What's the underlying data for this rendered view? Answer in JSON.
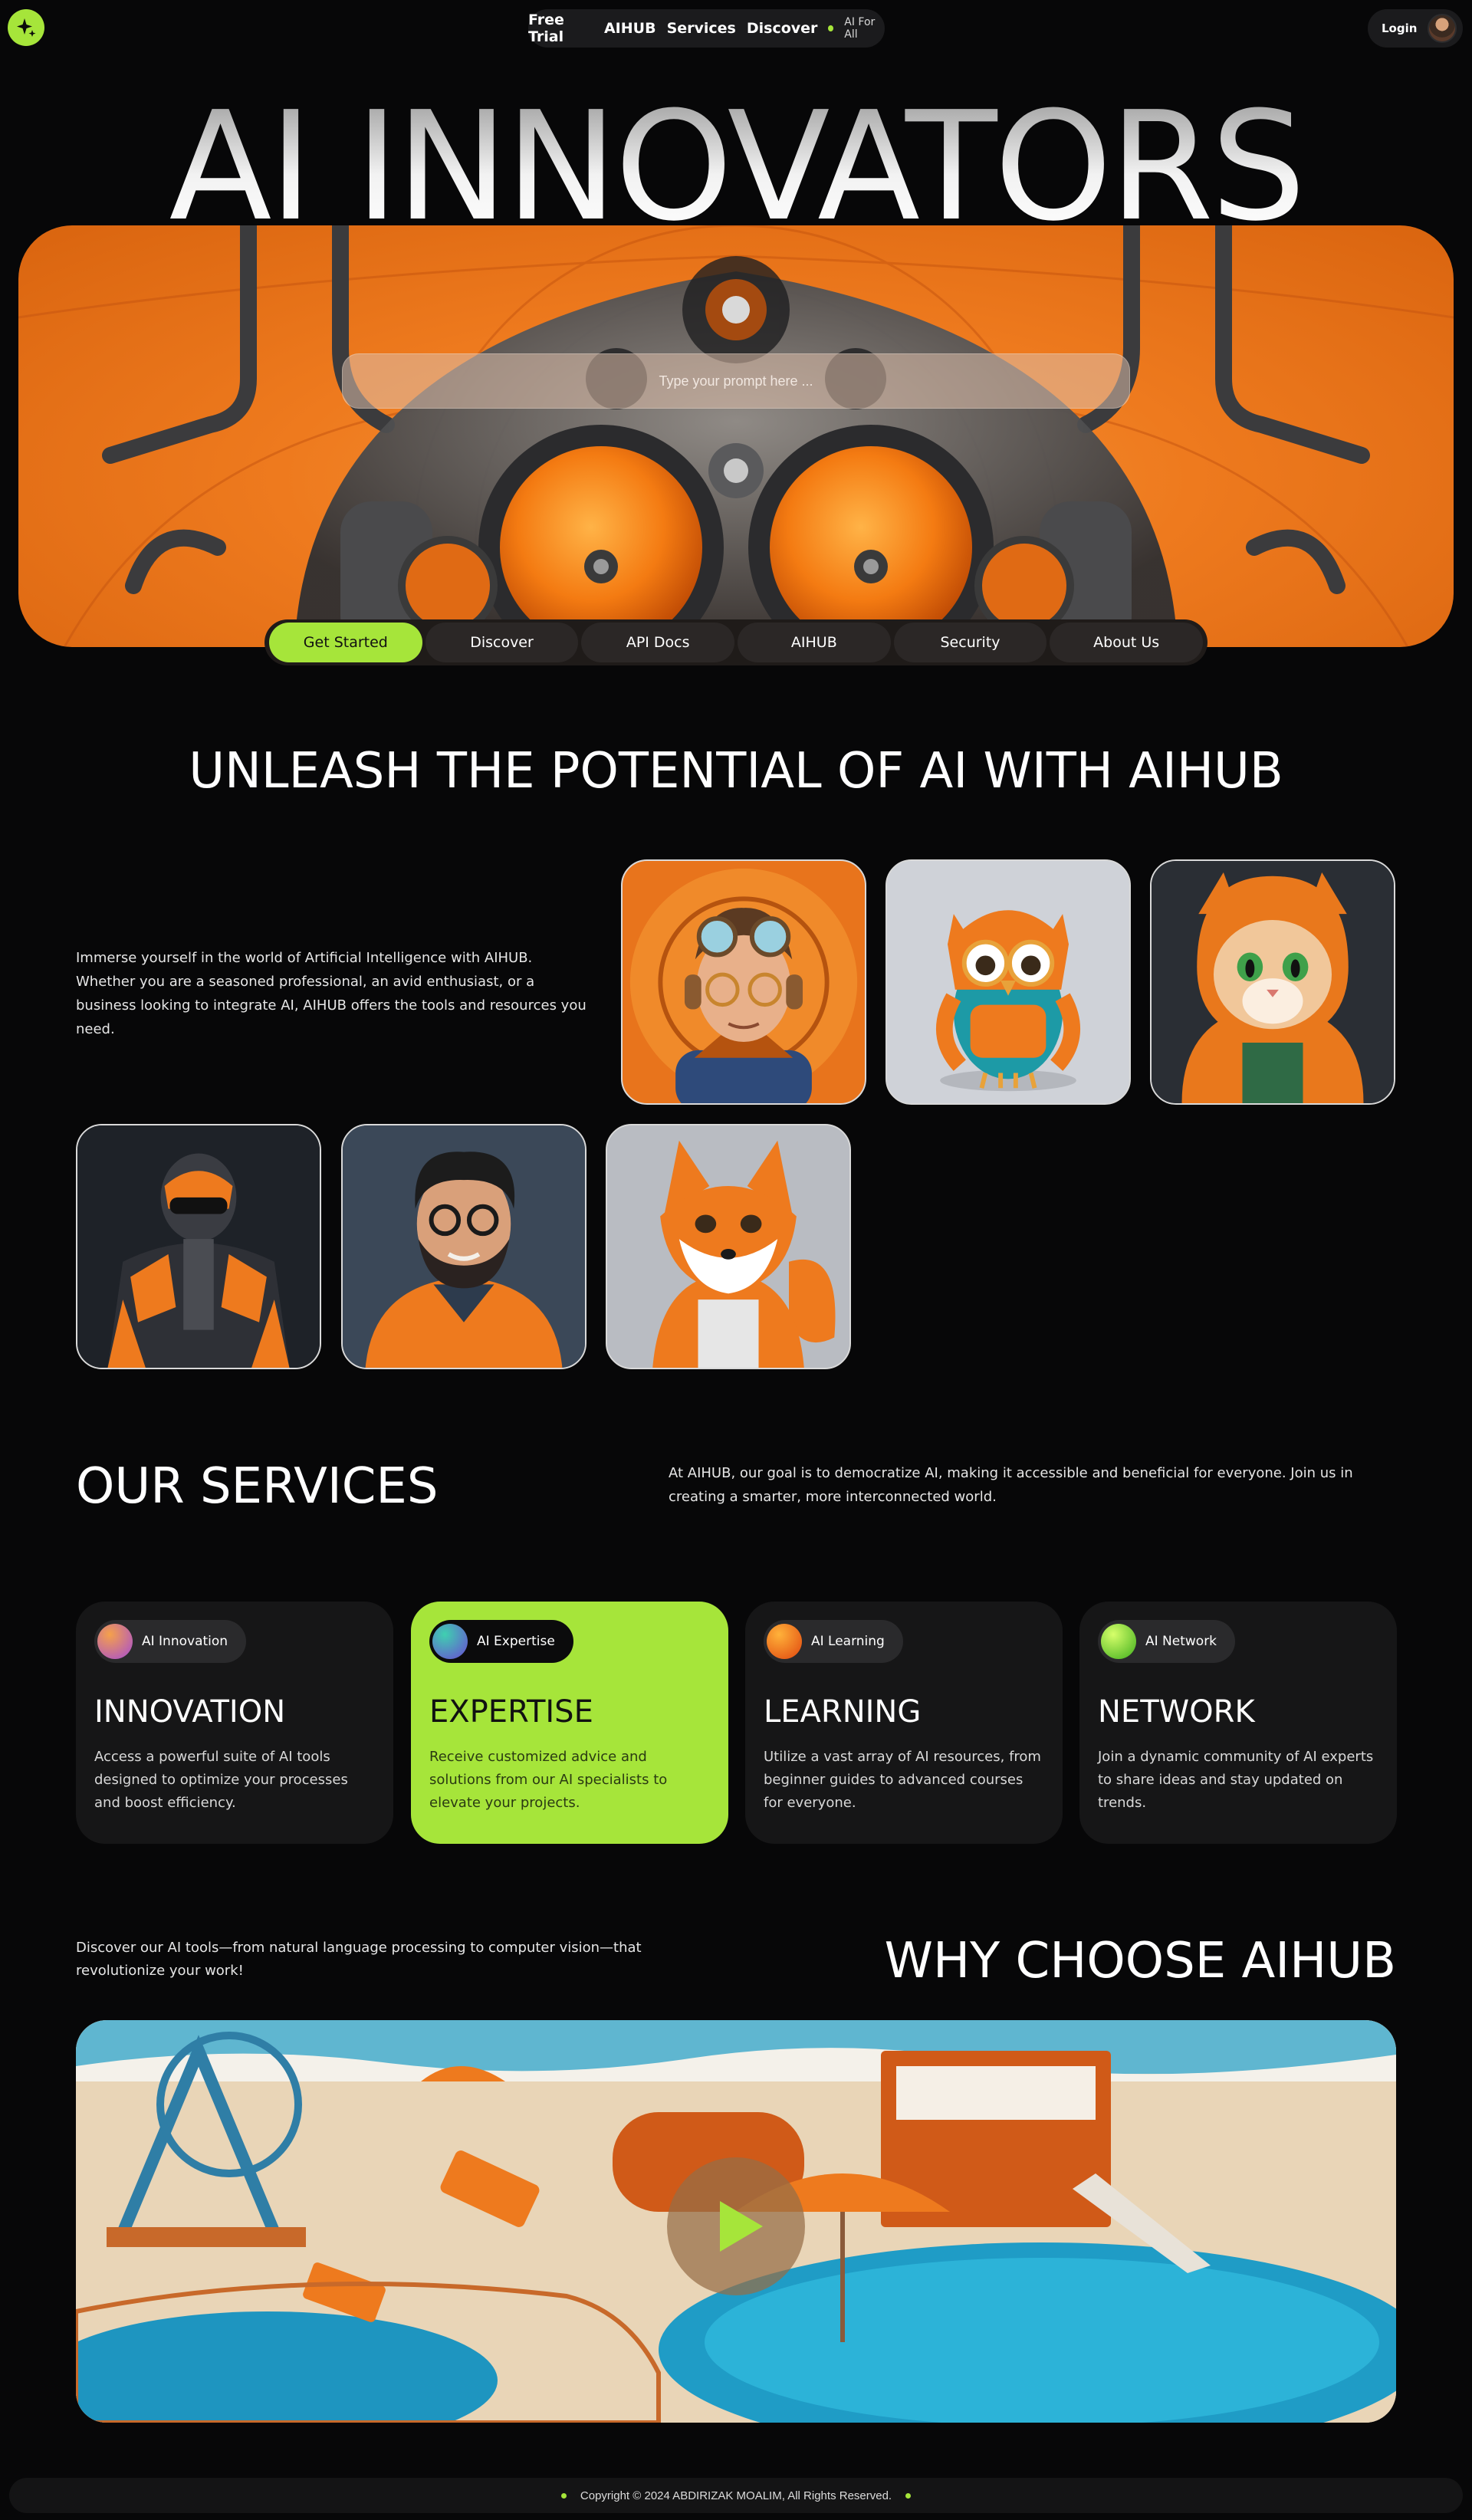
{
  "nav": {
    "links": [
      "Free Trial",
      "AIHUB",
      "Services",
      "Discover"
    ],
    "tagline": "AI For All",
    "login_label": "Login"
  },
  "hero": {
    "title": "AI INNOVATORS",
    "prompt_placeholder": "Type your prompt here ...",
    "tabs": [
      "Get Started",
      "Discover",
      "API Docs",
      "AIHUB",
      "Security",
      "About Us"
    ],
    "active_tab": "Get Started"
  },
  "unleash": {
    "title": "UNLEASH THE POTENTIAL OF AI WITH AIHUB",
    "intro": "Immerse yourself in the world of Artificial Intelligence with AIHUB. Whether you are a seasoned professional, an avid enthusiast, or a business looking to integrate AI, AIHUB offers the tools and resources you need."
  },
  "services": {
    "title": "OUR SERVICES",
    "description": "At AIHUB, our goal is to democratize AI, making it accessible and beneficial for everyone. Join us in creating a smarter, more interconnected world.",
    "cards": [
      {
        "pill": "AI Innovation",
        "heading": "INNOVATION",
        "text": "Access a powerful suite of AI tools designed to optimize your processes and boost efficiency."
      },
      {
        "pill": "AI Expertise",
        "heading": "EXPERTISE",
        "text": "Receive customized advice and solutions from our AI specialists to elevate your projects."
      },
      {
        "pill": "AI Learning",
        "heading": "LEARNING",
        "text": "Utilize a vast array of AI resources, from beginner guides to advanced courses for everyone."
      },
      {
        "pill": "AI Network",
        "heading": "NETWORK",
        "text": "Join a dynamic community of AI experts to share ideas and stay updated on trends."
      }
    ]
  },
  "why": {
    "discover_text": "Discover our AI tools—from natural language processing to computer vision—that revolutionize your work!",
    "title": "WHY CHOOSE AIHUB"
  },
  "footer": {
    "copyright": "Copyright © 2024 ABDIRIZAK MOALIM, All Rights Reserved."
  },
  "colors": {
    "accent": "#a6e53a",
    "background": "#070708",
    "card": "#161617",
    "hero_orange": "#ee7a1e"
  }
}
